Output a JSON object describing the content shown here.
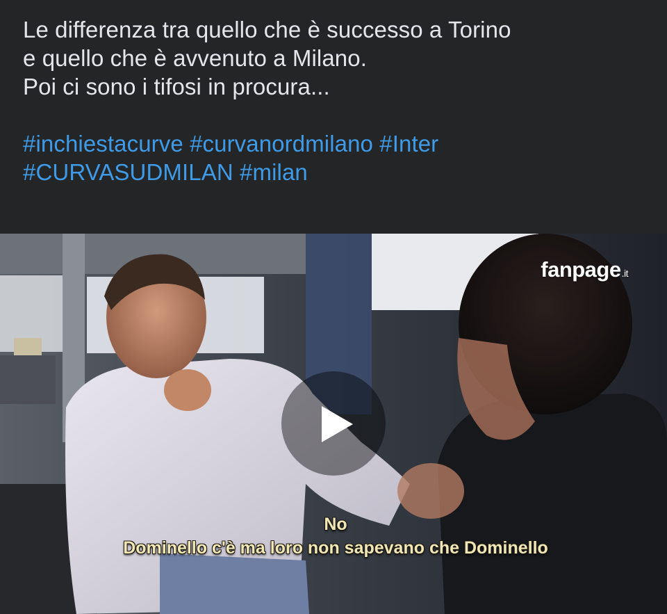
{
  "post": {
    "text_lines": [
      "Le differenza tra quello che è successo a Torino",
      "e quello che è avvenuto a Milano.",
      "Poi ci sono i tifosi in procura..."
    ],
    "hashtags_line1": [
      "#inchiestacurve",
      "#curvanordmilano",
      "#Inter"
    ],
    "hashtags_line2": [
      "#CURVASUDMILAN",
      "#milan"
    ]
  },
  "video": {
    "watermark_brand": "fanpage",
    "watermark_tld": ".it",
    "subtitle_line1": "No",
    "subtitle_line2": "Dominello c'è ma loro non sapevano che Dominello",
    "play_icon": "play-icon"
  },
  "colors": {
    "background": "#242526",
    "text": "#e4e6eb",
    "hashtag": "#3f9be8",
    "subtitle": "#f0e6b6"
  }
}
